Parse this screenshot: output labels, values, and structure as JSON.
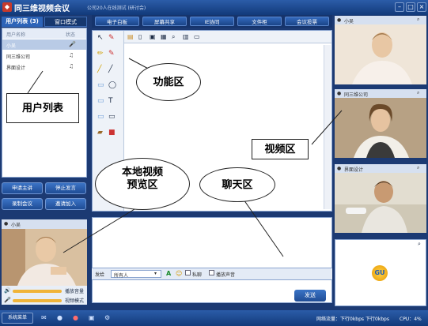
{
  "app": {
    "title": "同三维视频会议",
    "subtitle": "公司20人在线测试 (研讨会)"
  },
  "left_panel": {
    "tabs": [
      {
        "label": "用户列表 (3)"
      },
      {
        "label": "窗口模式"
      }
    ],
    "columns": {
      "name": "用户名称",
      "status": "状态"
    },
    "users": [
      {
        "name": "小吴",
        "status_icon": "mic-icon"
      },
      {
        "name": "同三维公司",
        "status_icon": "headset-icon"
      },
      {
        "name": "界面设计",
        "status_icon": "headset-icon"
      }
    ],
    "buttons": {
      "apply_host": "申请主讲",
      "stop_speaking": "停止发言",
      "record": "录制会议",
      "invite": "邀请加入"
    },
    "local_video_label": "小吴",
    "volume": {
      "play": "播放音量",
      "video_mode": "视频模式"
    }
  },
  "menu": {
    "items": [
      "电子白板",
      "屏幕共享",
      "IE协同",
      "文件柜",
      "会议投票"
    ]
  },
  "chat": {
    "send_to_label": "发给",
    "send_to_value": "所有人",
    "private_label": "私聊",
    "sound_label": "播放声音",
    "send_button": "发送"
  },
  "videos": [
    {
      "label": "小吴"
    },
    {
      "label": "同三维公司"
    },
    {
      "label": "界面设计"
    }
  ],
  "statusbar": {
    "menu": "系统菜单",
    "traffic": "网络流量：下行0kbps 下行0kbps",
    "cpu": "CPU：4%"
  },
  "annotations": {
    "function_area": "功能区",
    "user_list": "用户列表",
    "video_area": "视频区",
    "local_preview_line1": "本地视频",
    "local_preview_line2": "预览区",
    "chat_area": "聊天区"
  },
  "colors": {
    "frame": "#1c3a73",
    "titlebar": "#2b5ca8",
    "accent_button": "#2f66b9",
    "logo": "#c63a2c"
  }
}
